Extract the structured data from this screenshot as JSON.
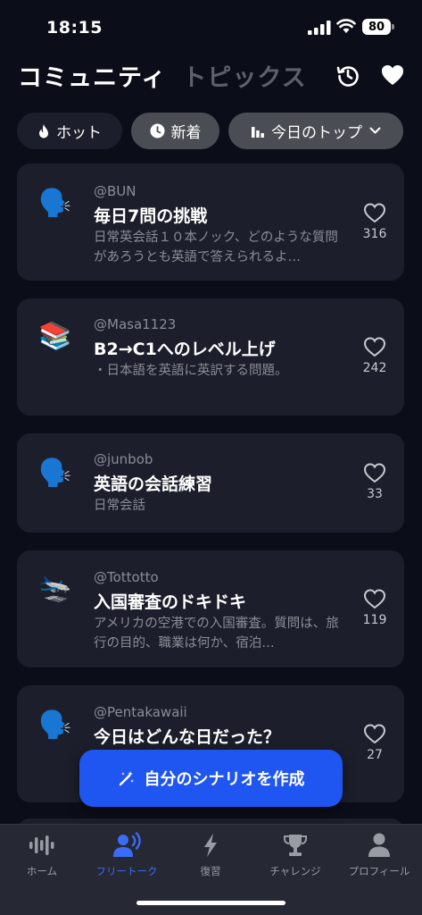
{
  "status_bar": {
    "time": "18:15",
    "battery": "80"
  },
  "header": {
    "tab_active": "コミュニティ",
    "tab_inactive": "トピックス"
  },
  "filters": {
    "hot": "ホット",
    "new": "新着",
    "top": "今日のトップ"
  },
  "cards": [
    {
      "author": "@BUN",
      "title": "毎日7問の挑戦",
      "desc": "日常英会話１０本ノック、どのような質問があろうとも英語で答えられるよ…",
      "likes": "316",
      "icon": "🗣️"
    },
    {
      "author": "@Masa1123",
      "title": "B2→C1へのレベル上げ",
      "desc": "・日本語を英語に英訳する問題。",
      "likes": "242",
      "icon": "📚"
    },
    {
      "author": "@junbob",
      "title": "英語の会話練習",
      "desc": "日常会話",
      "likes": "33",
      "icon": "🗣️"
    },
    {
      "author": "@Tottotto",
      "title": "入国審査のドキドキ",
      "desc": "アメリカの空港での入国審査。質問は、旅行の目的、職業は何か、宿泊…",
      "likes": "119",
      "icon": "🛬"
    },
    {
      "author": "@Pentakawaii",
      "title": "今日はどんな日だった？",
      "desc": "",
      "likes": "27",
      "icon": "🗣️"
    }
  ],
  "create_button": "自分のシナリオを作成",
  "nav": {
    "home": "ホーム",
    "free_talk": "フリートーク",
    "review": "復習",
    "challenge": "チャレンジ",
    "profile": "プロフィール"
  },
  "colors": {
    "accent": "#1f55f0",
    "active_nav": "#3b6cf6",
    "card_bg": "#1c1f2b",
    "page_bg": "#0b0e19"
  }
}
